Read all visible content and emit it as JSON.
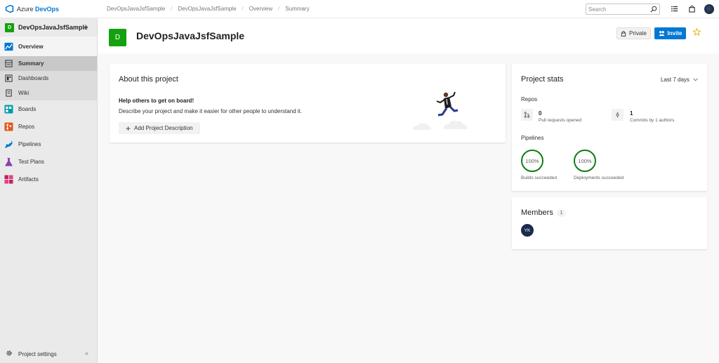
{
  "app": {
    "name_prefix": "Azure",
    "name_brand": "DevOps"
  },
  "breadcrumbs": [
    "DevOpsJavaJsfSample",
    "DevOpsJavaJsfSample",
    "Overview",
    "Summary"
  ],
  "search": {
    "placeholder": "Search",
    "value": ""
  },
  "project": {
    "name": "DevOpsJavaJsfSample",
    "initial": "D"
  },
  "sidebar": {
    "items": [
      {
        "label": "Overview"
      },
      {
        "label": "Summary"
      },
      {
        "label": "Dashboards"
      },
      {
        "label": "Wiki"
      },
      {
        "label": "Boards"
      },
      {
        "label": "Repos"
      },
      {
        "label": "Pipelines"
      },
      {
        "label": "Test Plans"
      },
      {
        "label": "Artifacts"
      }
    ],
    "settings_label": "Project settings"
  },
  "header": {
    "private_label": "Private",
    "invite_label": "Invite"
  },
  "about": {
    "title": "About this project",
    "help_title": "Help others to get on board!",
    "description": "Describe your project and make it easier for other people to understand it.",
    "button_label": "Add Project Description"
  },
  "stats": {
    "title": "Project stats",
    "range": "Last 7 days",
    "repos_label": "Repos",
    "pull_requests": {
      "value": "0",
      "label": "Pull requests opened"
    },
    "commits": {
      "value": "1",
      "label": "Commits by 1 authors"
    },
    "pipelines_label": "Pipelines",
    "builds": {
      "value": "100%",
      "label": "Builds succeeded"
    },
    "deployments": {
      "value": "100%",
      "label": "Deployments succeeded"
    }
  },
  "members": {
    "title": "Members",
    "count": "1",
    "avatars": [
      "YK"
    ]
  },
  "colors": {
    "accent": "#0078d4",
    "project_badge": "#13a10e",
    "success": "#107c10",
    "star": "#f2a900"
  }
}
